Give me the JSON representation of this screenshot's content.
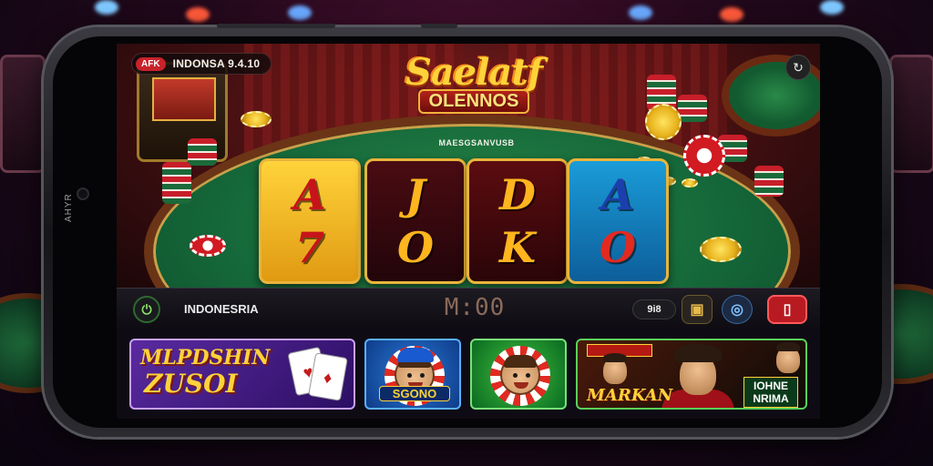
{
  "status_bar": {
    "badge": "AFK",
    "text": "INDONSA 9.4.10"
  },
  "logo": {
    "title": "Saelatf",
    "subtitle": "OLENNOS",
    "caption": "MAESGSANVUSB"
  },
  "reels": [
    {
      "top": "A",
      "bottom": "7"
    },
    {
      "top": "J",
      "bottom": "O"
    },
    {
      "top": "D",
      "bottom": "K"
    },
    {
      "top": "A",
      "bottom": "O"
    }
  ],
  "bottom_bar": {
    "region": "INDONESRIA",
    "balance": "M:00",
    "badge": "9i8"
  },
  "promos": {
    "card1_line1": "MLPDSHIN",
    "card1_line2": "ZUSOI",
    "card2_label": "SGONO",
    "card4_title": "MARKAN",
    "card4_tag_line1": "IOHNE",
    "card4_tag_line2": "NRIMA"
  },
  "bezel": {
    "left": "AHYR"
  },
  "colors": {
    "felt": "#15683a",
    "accent_gold": "#ffd23a",
    "accent_red": "#c8222a"
  }
}
